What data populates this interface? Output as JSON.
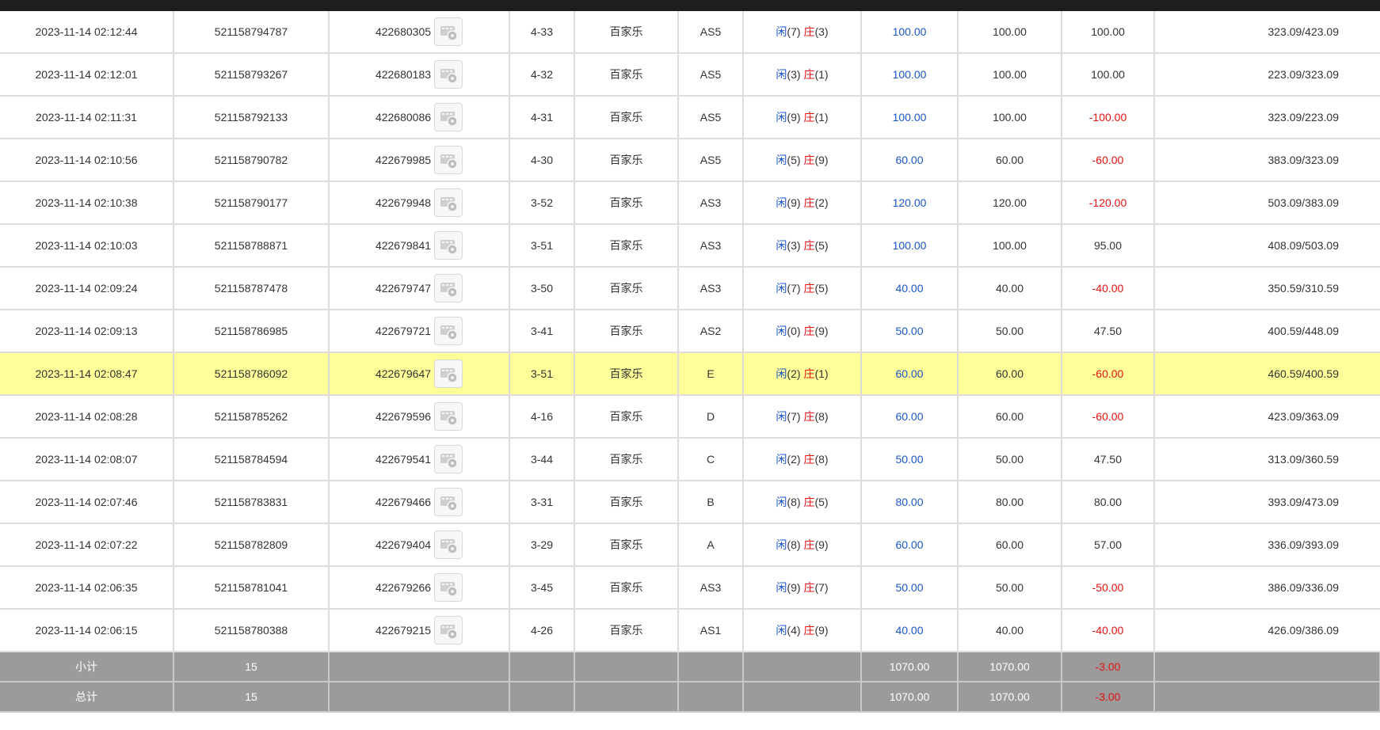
{
  "labels": {
    "player": "闲",
    "banker": "庄"
  },
  "colors": {
    "blue": "#1a56c8",
    "red": "#e81010",
    "highlight": "#ffff99",
    "summary_bg": "#9b9b9b"
  },
  "rows": [
    {
      "time": "2023-11-14 02:12:44",
      "bet_id": "521158794787",
      "round_id": "422680305",
      "table": "4-33",
      "game": "百家乐",
      "code": "AS5",
      "p": "7",
      "b": "3",
      "bet": "100.00",
      "valid": "100.00",
      "win": "100.00",
      "win_neg": false,
      "balance": "323.09/423.09"
    },
    {
      "time": "2023-11-14 02:12:01",
      "bet_id": "521158793267",
      "round_id": "422680183",
      "table": "4-32",
      "game": "百家乐",
      "code": "AS5",
      "p": "3",
      "b": "1",
      "bet": "100.00",
      "valid": "100.00",
      "win": "100.00",
      "win_neg": false,
      "balance": "223.09/323.09"
    },
    {
      "time": "2023-11-14 02:11:31",
      "bet_id": "521158792133",
      "round_id": "422680086",
      "table": "4-31",
      "game": "百家乐",
      "code": "AS5",
      "p": "9",
      "b": "1",
      "bet": "100.00",
      "valid": "100.00",
      "win": "-100.00",
      "win_neg": true,
      "balance": "323.09/223.09"
    },
    {
      "time": "2023-11-14 02:10:56",
      "bet_id": "521158790782",
      "round_id": "422679985",
      "table": "4-30",
      "game": "百家乐",
      "code": "AS5",
      "p": "5",
      "b": "9",
      "bet": "60.00",
      "valid": "60.00",
      "win": "-60.00",
      "win_neg": true,
      "balance": "383.09/323.09"
    },
    {
      "time": "2023-11-14 02:10:38",
      "bet_id": "521158790177",
      "round_id": "422679948",
      "table": "3-52",
      "game": "百家乐",
      "code": "AS3",
      "p": "9",
      "b": "2",
      "bet": "120.00",
      "valid": "120.00",
      "win": "-120.00",
      "win_neg": true,
      "balance": "503.09/383.09"
    },
    {
      "time": "2023-11-14 02:10:03",
      "bet_id": "521158788871",
      "round_id": "422679841",
      "table": "3-51",
      "game": "百家乐",
      "code": "AS3",
      "p": "3",
      "b": "5",
      "bet": "100.00",
      "valid": "100.00",
      "win": "95.00",
      "win_neg": false,
      "balance": "408.09/503.09"
    },
    {
      "time": "2023-11-14 02:09:24",
      "bet_id": "521158787478",
      "round_id": "422679747",
      "table": "3-50",
      "game": "百家乐",
      "code": "AS3",
      "p": "7",
      "b": "5",
      "bet": "40.00",
      "valid": "40.00",
      "win": "-40.00",
      "win_neg": true,
      "balance": "350.59/310.59"
    },
    {
      "time": "2023-11-14 02:09:13",
      "bet_id": "521158786985",
      "round_id": "422679721",
      "table": "3-41",
      "game": "百家乐",
      "code": "AS2",
      "p": "0",
      "b": "9",
      "bet": "50.00",
      "valid": "50.00",
      "win": "47.50",
      "win_neg": false,
      "balance": "400.59/448.09"
    },
    {
      "time": "2023-11-14 02:08:47",
      "bet_id": "521158786092",
      "round_id": "422679647",
      "table": "3-51",
      "game": "百家乐",
      "code": "E",
      "p": "2",
      "b": "1",
      "bet": "60.00",
      "valid": "60.00",
      "win": "-60.00",
      "win_neg": true,
      "balance": "460.59/400.59",
      "highlight": true
    },
    {
      "time": "2023-11-14 02:08:28",
      "bet_id": "521158785262",
      "round_id": "422679596",
      "table": "4-16",
      "game": "百家乐",
      "code": "D",
      "p": "7",
      "b": "8",
      "bet": "60.00",
      "valid": "60.00",
      "win": "-60.00",
      "win_neg": true,
      "balance": "423.09/363.09"
    },
    {
      "time": "2023-11-14 02:08:07",
      "bet_id": "521158784594",
      "round_id": "422679541",
      "table": "3-44",
      "game": "百家乐",
      "code": "C",
      "p": "2",
      "b": "8",
      "bet": "50.00",
      "valid": "50.00",
      "win": "47.50",
      "win_neg": false,
      "balance": "313.09/360.59"
    },
    {
      "time": "2023-11-14 02:07:46",
      "bet_id": "521158783831",
      "round_id": "422679466",
      "table": "3-31",
      "game": "百家乐",
      "code": "B",
      "p": "8",
      "b": "5",
      "bet": "80.00",
      "valid": "80.00",
      "win": "80.00",
      "win_neg": false,
      "balance": "393.09/473.09"
    },
    {
      "time": "2023-11-14 02:07:22",
      "bet_id": "521158782809",
      "round_id": "422679404",
      "table": "3-29",
      "game": "百家乐",
      "code": "A",
      "p": "8",
      "b": "9",
      "bet": "60.00",
      "valid": "60.00",
      "win": "57.00",
      "win_neg": false,
      "balance": "336.09/393.09"
    },
    {
      "time": "2023-11-14 02:06:35",
      "bet_id": "521158781041",
      "round_id": "422679266",
      "table": "3-45",
      "game": "百家乐",
      "code": "AS3",
      "p": "9",
      "b": "7",
      "bet": "50.00",
      "valid": "50.00",
      "win": "-50.00",
      "win_neg": true,
      "balance": "386.09/336.09"
    },
    {
      "time": "2023-11-14 02:06:15",
      "bet_id": "521158780388",
      "round_id": "422679215",
      "table": "4-26",
      "game": "百家乐",
      "code": "AS1",
      "p": "4",
      "b": "9",
      "bet": "40.00",
      "valid": "40.00",
      "win": "-40.00",
      "win_neg": true,
      "balance": "426.09/386.09"
    }
  ],
  "summary": [
    {
      "label": "小计",
      "count": "15",
      "bet": "1070.00",
      "valid": "1070.00",
      "win": "-3.00"
    },
    {
      "label": "总计",
      "count": "15",
      "bet": "1070.00",
      "valid": "1070.00",
      "win": "-3.00"
    }
  ]
}
